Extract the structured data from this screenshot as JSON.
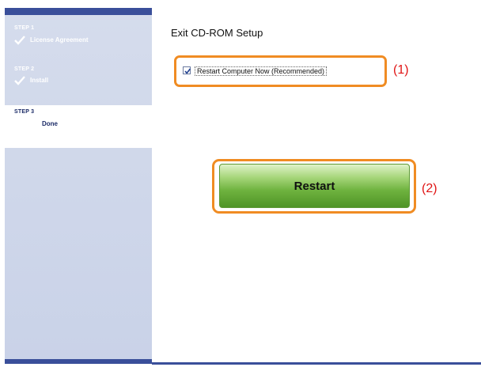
{
  "sidebar": {
    "steps": [
      {
        "number": "STEP 1",
        "label": "License Agreement",
        "status": "done"
      },
      {
        "number": "STEP 2",
        "label": "Install",
        "status": "done"
      },
      {
        "number": "STEP 3",
        "label": "Done",
        "status": "current"
      }
    ]
  },
  "main": {
    "title": "Exit CD-ROM Setup",
    "restart_checkbox": {
      "label": "Restart Computer Now (Recommended)",
      "checked": true
    },
    "restart_button_label": "Restart",
    "callouts": [
      "(1)",
      "(2)"
    ]
  },
  "colors": {
    "sidebar_bg": "#c9d2e8",
    "sidebar_bar": "#3a4f9a",
    "highlight_border": "#f08c23",
    "callout_text": "#e01414",
    "button_green": "#6fb33f"
  }
}
